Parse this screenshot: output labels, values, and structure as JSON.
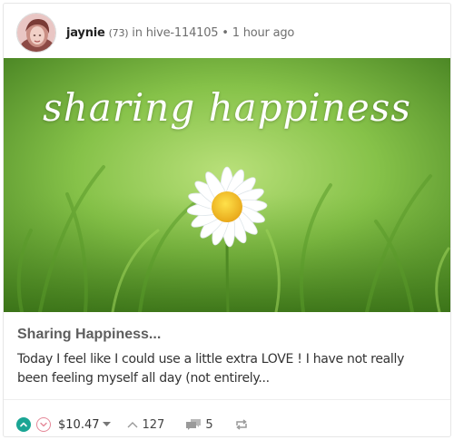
{
  "post": {
    "author": "jaynie",
    "reputation": "(73)",
    "community_prefix": "in",
    "community": "hive-114105",
    "separator": "•",
    "time": "1 hour ago",
    "image_caption": "sharing happiness",
    "title": "Sharing Happiness...",
    "excerpt": "Today I feel like I could use a little extra LOVE ! I have not really been feeling myself all day (not entirely..."
  },
  "footer": {
    "payout": "$10.47",
    "votes": "127",
    "comments": "5"
  },
  "icons": {
    "upvote": "upvote-icon",
    "downvote": "downvote-icon",
    "votes": "votes-chevron-icon",
    "comments": "comments-icon",
    "reblog": "reblog-icon"
  },
  "colors": {
    "upvote": "#1aa594",
    "downvote": "#e58898",
    "grass_dark": "#4e8a23",
    "grass_light": "#a9d96b"
  }
}
